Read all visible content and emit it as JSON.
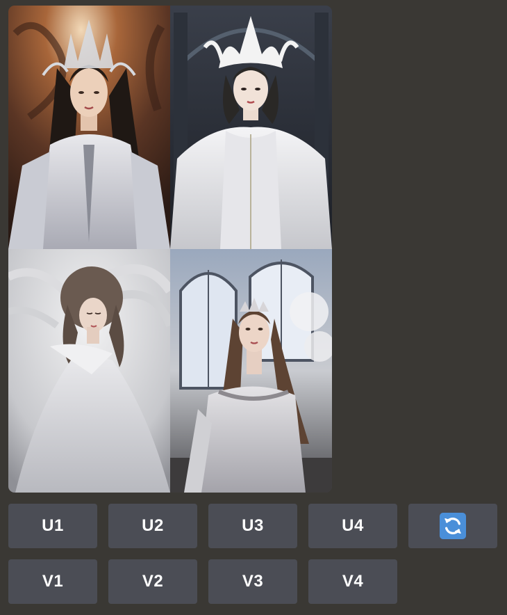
{
  "image_grid": {
    "cells": [
      {
        "name": "image-1",
        "description_icon": "portrait-image"
      },
      {
        "name": "image-2",
        "description_icon": "portrait-image"
      },
      {
        "name": "image-3",
        "description_icon": "portrait-image"
      },
      {
        "name": "image-4",
        "description_icon": "portrait-image"
      }
    ]
  },
  "upscale_buttons": [
    {
      "label": "U1"
    },
    {
      "label": "U2"
    },
    {
      "label": "U3"
    },
    {
      "label": "U4"
    }
  ],
  "reroll_button": {
    "icon": "refresh-icon",
    "icon_color": "#4a8fd9"
  },
  "variation_buttons": [
    {
      "label": "V1"
    },
    {
      "label": "V2"
    },
    {
      "label": "V3"
    },
    {
      "label": "V4"
    }
  ],
  "colors": {
    "background": "#3a3834",
    "button": "#4b4d55",
    "button_text": "#ffffff"
  }
}
